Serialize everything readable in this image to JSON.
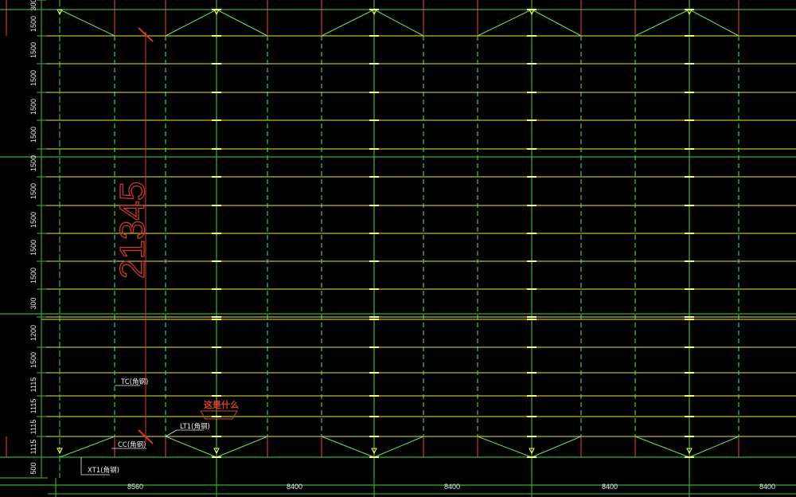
{
  "drawing": {
    "background": "#000000",
    "colors": {
      "grid_yellow": "#e6e63c",
      "axis_green": "#44d844",
      "brace_green": "#5fe85f",
      "column_red": "#d23a2a",
      "dim_green": "#37c437",
      "annotation_red": "#c83a2e",
      "text_white": "#f0f0f0"
    },
    "left_dims": [
      "300",
      "1500",
      "1500",
      "1500",
      "1500",
      "1500",
      "1500",
      "1500",
      "1500",
      "1500",
      "1500",
      "300",
      "1200",
      "1500",
      "1115",
      "1115",
      "1115",
      "1115",
      "500"
    ],
    "bottom_dims": [
      "8560",
      "8400",
      "8400",
      "8400",
      "8400"
    ],
    "overall_dim": "21345",
    "labels": {
      "tc": "TC(角钢)",
      "lt1": "LT1(角钢)",
      "cc": "CC(角钢)",
      "xt1": "XT1(角钢)",
      "question": "这是什么"
    },
    "icons": [
      "tick-mark-icon",
      "triangle-marker-icon",
      "leader-arrow-icon"
    ]
  }
}
